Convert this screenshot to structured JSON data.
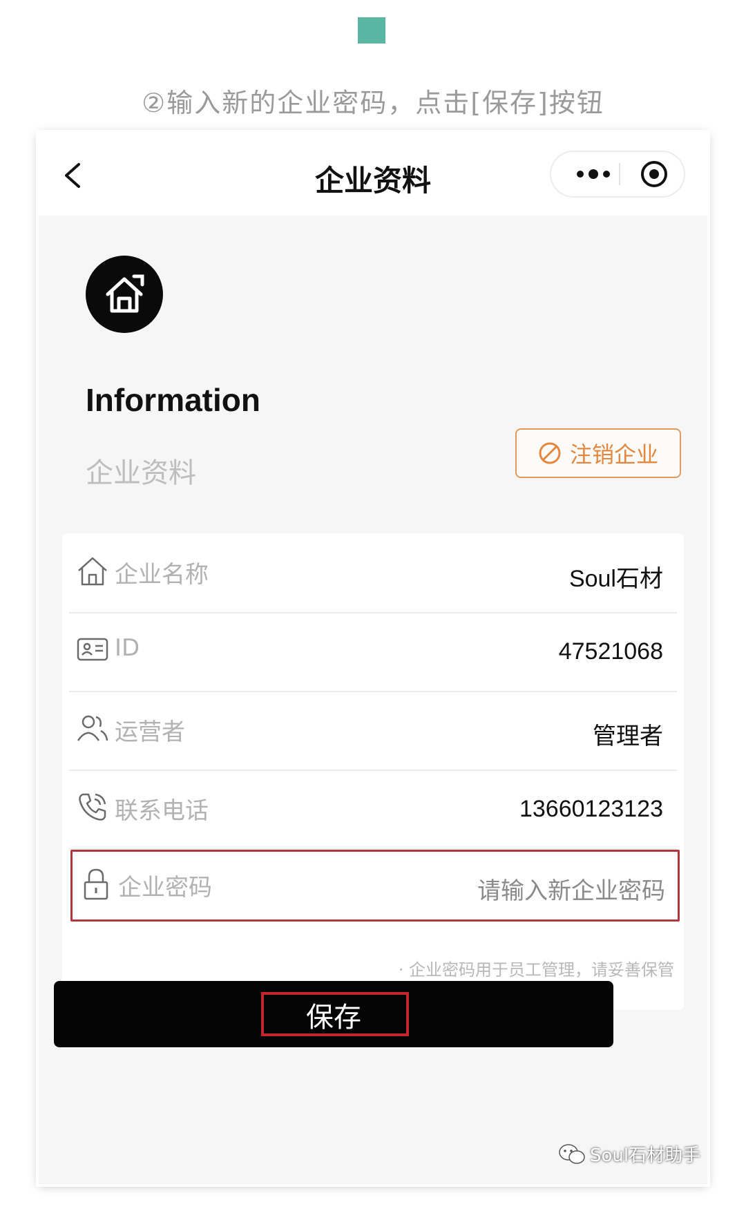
{
  "caption": "②输入新的企业密码，点击[保存]按钮",
  "colors": {
    "accent_teal": "#58b6a2",
    "cancel_orange": "#e4873e",
    "highlight_red": "#c2272d",
    "save_bg": "#050505"
  },
  "navbar": {
    "title": "企业资料",
    "back_icon": "chevron-left-icon",
    "more_icon": "more-dots-icon",
    "close_icon": "target-circle-icon"
  },
  "header": {
    "logo_icon": "house-icon",
    "title": "Information",
    "subtitle": "企业资料",
    "cancel_button": "注销企业",
    "cancel_icon": "prohibited-icon"
  },
  "rows": [
    {
      "icon": "house-outline-icon",
      "label": "企业名称",
      "value": "Soul石材"
    },
    {
      "icon": "id-card-icon",
      "label": "ID",
      "value": "47521068"
    },
    {
      "icon": "users-icon",
      "label": "运营者",
      "value": "管理者"
    },
    {
      "icon": "phone-icon",
      "label": "联系电话",
      "value": "13660123123"
    }
  ],
  "password": {
    "icon": "lock-icon",
    "label": "企业密码",
    "placeholder": "请输入新企业密码",
    "hint": "· 企业密码用于员工管理，请妥善保管"
  },
  "save": {
    "label": "保存"
  },
  "watermark": "Soul石材助手"
}
